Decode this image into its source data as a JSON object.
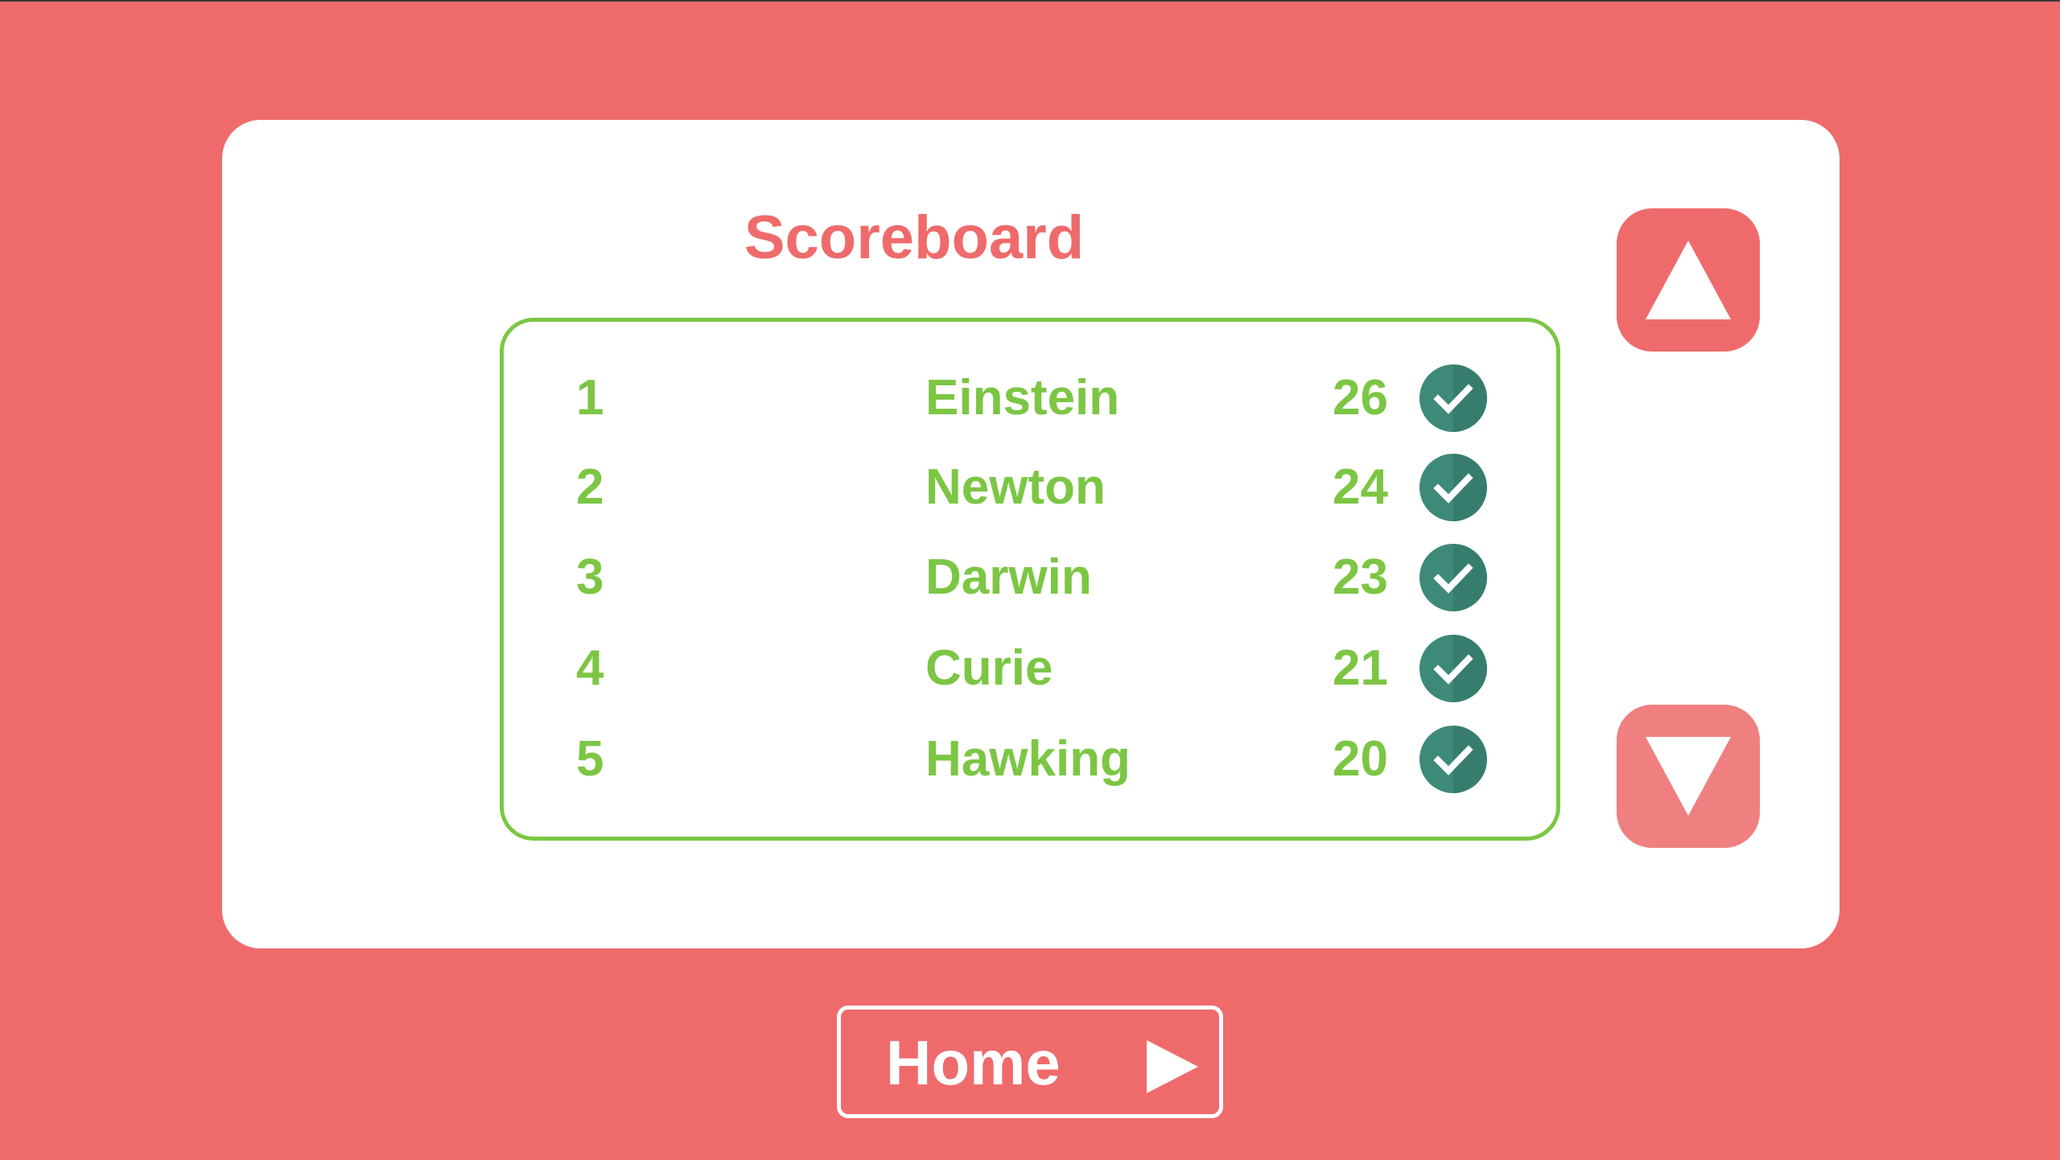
{
  "title": "Scoreboard",
  "colors": {
    "background": "#ef6b6b",
    "panel": "#ffffff",
    "text_green": "#7cc644",
    "check_badge": "#3d8a78"
  },
  "scoreboard": {
    "rows": [
      {
        "rank": "1",
        "name": "Einstein",
        "score": "26",
        "status_icon": "check-circle-icon"
      },
      {
        "rank": "2",
        "name": "Newton",
        "score": "24",
        "status_icon": "check-circle-icon"
      },
      {
        "rank": "3",
        "name": "Darwin",
        "score": "23",
        "status_icon": "check-circle-icon"
      },
      {
        "rank": "4",
        "name": "Curie",
        "score": "21",
        "status_icon": "check-circle-icon"
      },
      {
        "rank": "5",
        "name": "Hawking",
        "score": "20",
        "status_icon": "check-circle-icon"
      }
    ]
  },
  "controls": {
    "scroll_up_icon": "triangle-up-icon",
    "scroll_down_icon": "triangle-down-icon"
  },
  "home_button": {
    "label": "Home",
    "icon": "play-arrow-icon"
  }
}
